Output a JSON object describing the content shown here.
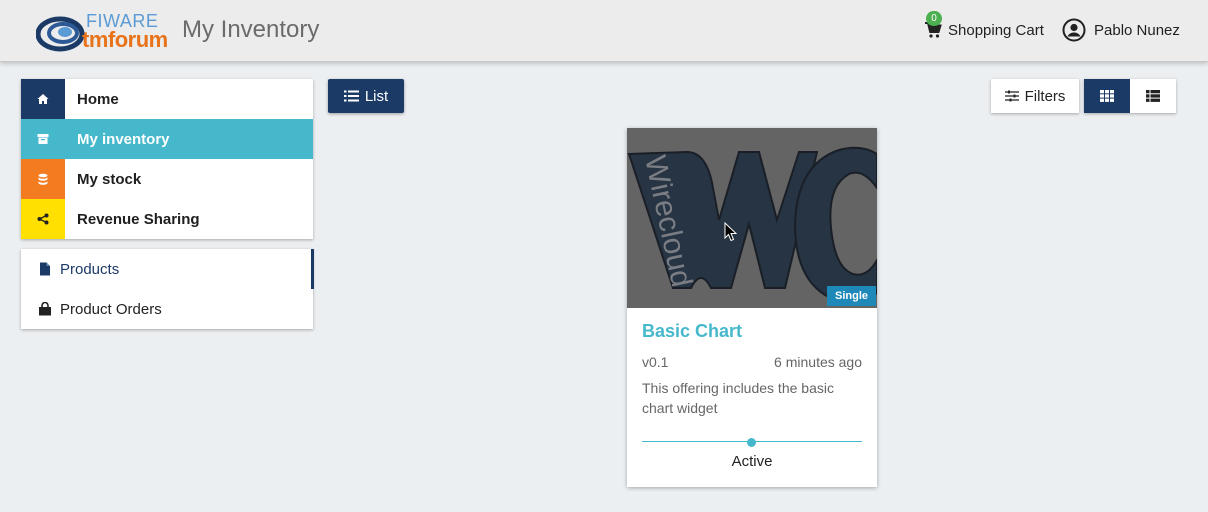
{
  "header": {
    "logo": {
      "line1": "FIWARE",
      "line2": "tmforum"
    },
    "title": "My Inventory",
    "cart": {
      "label": "Shopping Cart",
      "count": "0",
      "icon": "cart-icon"
    },
    "user": {
      "name": "Pablo Nunez",
      "icon": "user-circle-icon"
    }
  },
  "sidebar": {
    "items": [
      {
        "label": "Home",
        "icon": "home-icon",
        "color": "#1b3a66"
      },
      {
        "label": "My inventory",
        "icon": "archive-icon",
        "color": "#45b8cb",
        "active": true
      },
      {
        "label": "My stock",
        "icon": "database-icon",
        "color": "#f47c20"
      },
      {
        "label": "Revenue Sharing",
        "icon": "share-icon",
        "color": "#ffe000"
      }
    ],
    "sub_items": [
      {
        "label": "Products",
        "icon": "file-icon",
        "active": true
      },
      {
        "label": "Product Orders",
        "icon": "shopping-bag-icon"
      }
    ]
  },
  "toolbar": {
    "list_label": "List",
    "filters_label": "Filters",
    "view_modes": [
      "grid",
      "list"
    ],
    "active_view": "grid"
  },
  "products": [
    {
      "image_text": "Wirecloud",
      "badge": "Single",
      "title": "Basic Chart",
      "version": "v0.1",
      "time": "6 minutes ago",
      "description": "This offering includes the basic chart widget",
      "status": "Active"
    }
  ],
  "colors": {
    "primary": "#1b3a66",
    "accent": "#45b8cb",
    "badge": "#1e88b8",
    "cart_badge": "#4caf50"
  }
}
